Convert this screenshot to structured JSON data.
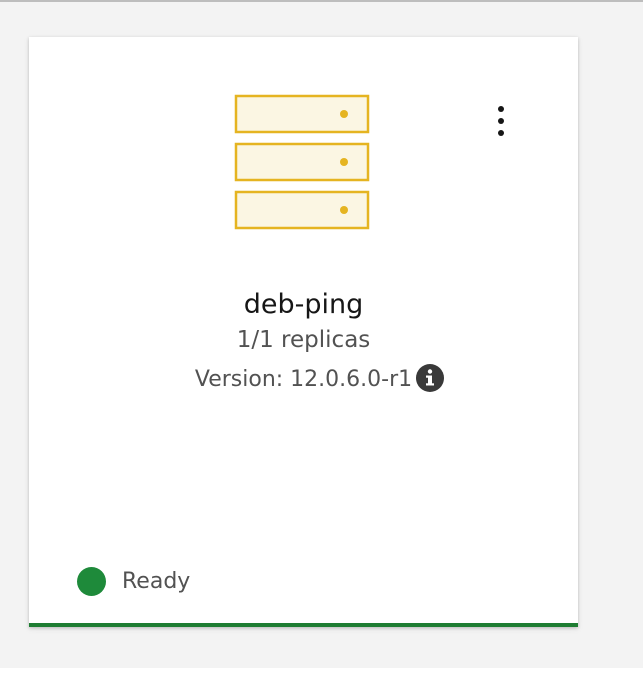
{
  "card": {
    "title": "deb-ping",
    "replicas": "1/1 replicas",
    "version": "Version: 12.0.6.0-r1",
    "status": "Ready",
    "icon": "server-stack-icon",
    "menu_icon": "overflow-menu-vertical-icon",
    "info_icon": "information-icon"
  },
  "colors": {
    "server_icon_stroke": "#e5b421",
    "server_icon_fill": "#fbf6e3",
    "status_ready": "#1e8a3a",
    "card_accent": "#1e7d32"
  }
}
